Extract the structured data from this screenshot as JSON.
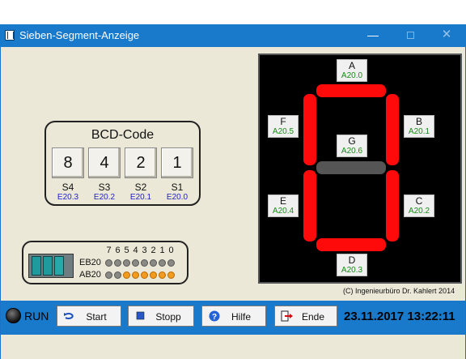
{
  "window": {
    "title": "Sieben-Segment-Anzeige",
    "minimize_icon": "minimize-icon",
    "maximize_icon": "maximize-icon",
    "close_icon": "close-icon"
  },
  "bcd": {
    "title": "BCD-Code",
    "digits": [
      {
        "value": "8",
        "label": "S4",
        "addr": "E20.3"
      },
      {
        "value": "4",
        "label": "S3",
        "addr": "E20.2"
      },
      {
        "value": "2",
        "label": "S2",
        "addr": "E20.1"
      },
      {
        "value": "1",
        "label": "S1",
        "addr": "E20.0"
      }
    ]
  },
  "plc": {
    "bit_numbers": [
      "7",
      "6",
      "5",
      "4",
      "3",
      "2",
      "1",
      "0"
    ],
    "rows": [
      {
        "label": "EB20",
        "leds": [
          false,
          false,
          false,
          false,
          false,
          false,
          false,
          false
        ]
      },
      {
        "label": "AB20",
        "leds": [
          false,
          false,
          true,
          true,
          true,
          true,
          true,
          true
        ]
      }
    ],
    "colors": {
      "led_on": "#f39a20",
      "led_off": "#8a8a84"
    }
  },
  "display": {
    "segment_on_color": "#ff0a0a",
    "segment_off_color": "#555555",
    "segments": {
      "A": {
        "label": "A",
        "addr": "A20.0",
        "on": true
      },
      "B": {
        "label": "B",
        "addr": "A20.1",
        "on": true
      },
      "C": {
        "label": "C",
        "addr": "A20.2",
        "on": true
      },
      "D": {
        "label": "D",
        "addr": "A20.3",
        "on": true
      },
      "E": {
        "label": "E",
        "addr": "A20.4",
        "on": true
      },
      "F": {
        "label": "F",
        "addr": "A20.5",
        "on": true
      },
      "G": {
        "label": "G",
        "addr": "A20.6",
        "on": false
      }
    }
  },
  "copyright": "(C) Ingenieurbüro Dr. Kahlert 2014",
  "status": {
    "run_label": "RUN",
    "run_led": "off"
  },
  "toolbar": {
    "start_label": "Start",
    "stop_label": "Stopp",
    "help_label": "Hilfe",
    "end_label": "Ende"
  },
  "datetime": "23.11.2017  13:22:11"
}
